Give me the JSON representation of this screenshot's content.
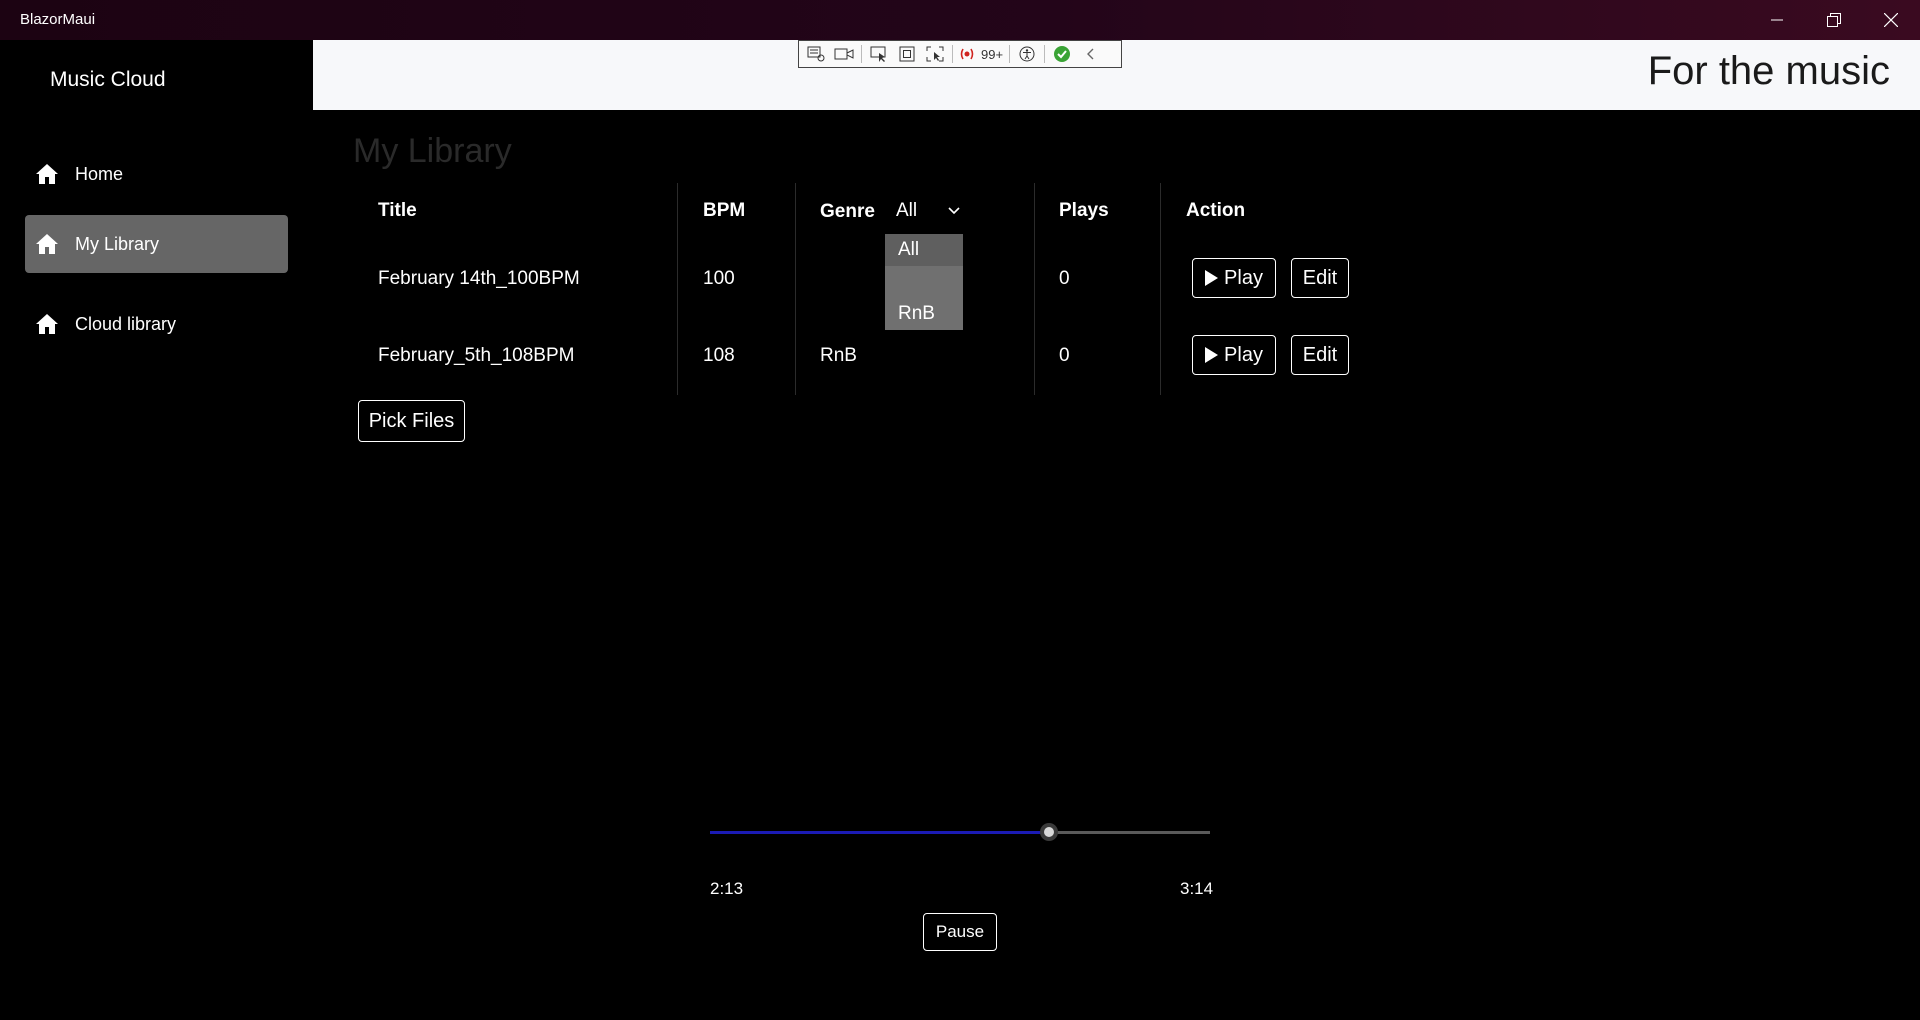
{
  "window": {
    "title": "BlazorMaui",
    "controls": [
      "minimize-icon",
      "restore-icon",
      "close-icon"
    ]
  },
  "sidebar": {
    "brand": "Music Cloud",
    "items": [
      {
        "label": "Home",
        "icon": "home-icon",
        "active": false
      },
      {
        "label": "My Library",
        "icon": "home-icon",
        "active": true
      },
      {
        "label": "Cloud library",
        "icon": "home-icon",
        "active": false
      }
    ]
  },
  "header": {
    "tagline": "For the music"
  },
  "devtools": {
    "badge_count": "99+",
    "icons": [
      "live-visual-tree-icon",
      "record-icon",
      "select-element-icon",
      "display-layout-adorners-icon",
      "track-focus-icon",
      "binding-failures-icon",
      "accessibility-icon",
      "hot-reload-ok-icon",
      "collapse-icon"
    ]
  },
  "page": {
    "title": "My Library",
    "table": {
      "headers": {
        "title": "Title",
        "bpm": "BPM",
        "genre": "Genre",
        "plays": "Plays",
        "action": "Action"
      },
      "genre_filter": {
        "value": "All",
        "options": [
          "All",
          "",
          "RnB"
        ]
      },
      "rows": [
        {
          "title": "February 14th_100BPM",
          "bpm": "100",
          "genre": "",
          "plays": "0",
          "play_label": "Play",
          "edit_label": "Edit"
        },
        {
          "title": "February_5th_108BPM",
          "bpm": "108",
          "genre": "RnB",
          "plays": "0",
          "play_label": "Play",
          "edit_label": "Edit"
        }
      ]
    },
    "pick_files_label": "Pick Files"
  },
  "player": {
    "current_time": "2:13",
    "total_time": "3:14",
    "progress": 0.677,
    "pause_label": "Pause",
    "colors": {
      "fill": "#1b1bb5",
      "track": "#5a5a5a"
    }
  }
}
